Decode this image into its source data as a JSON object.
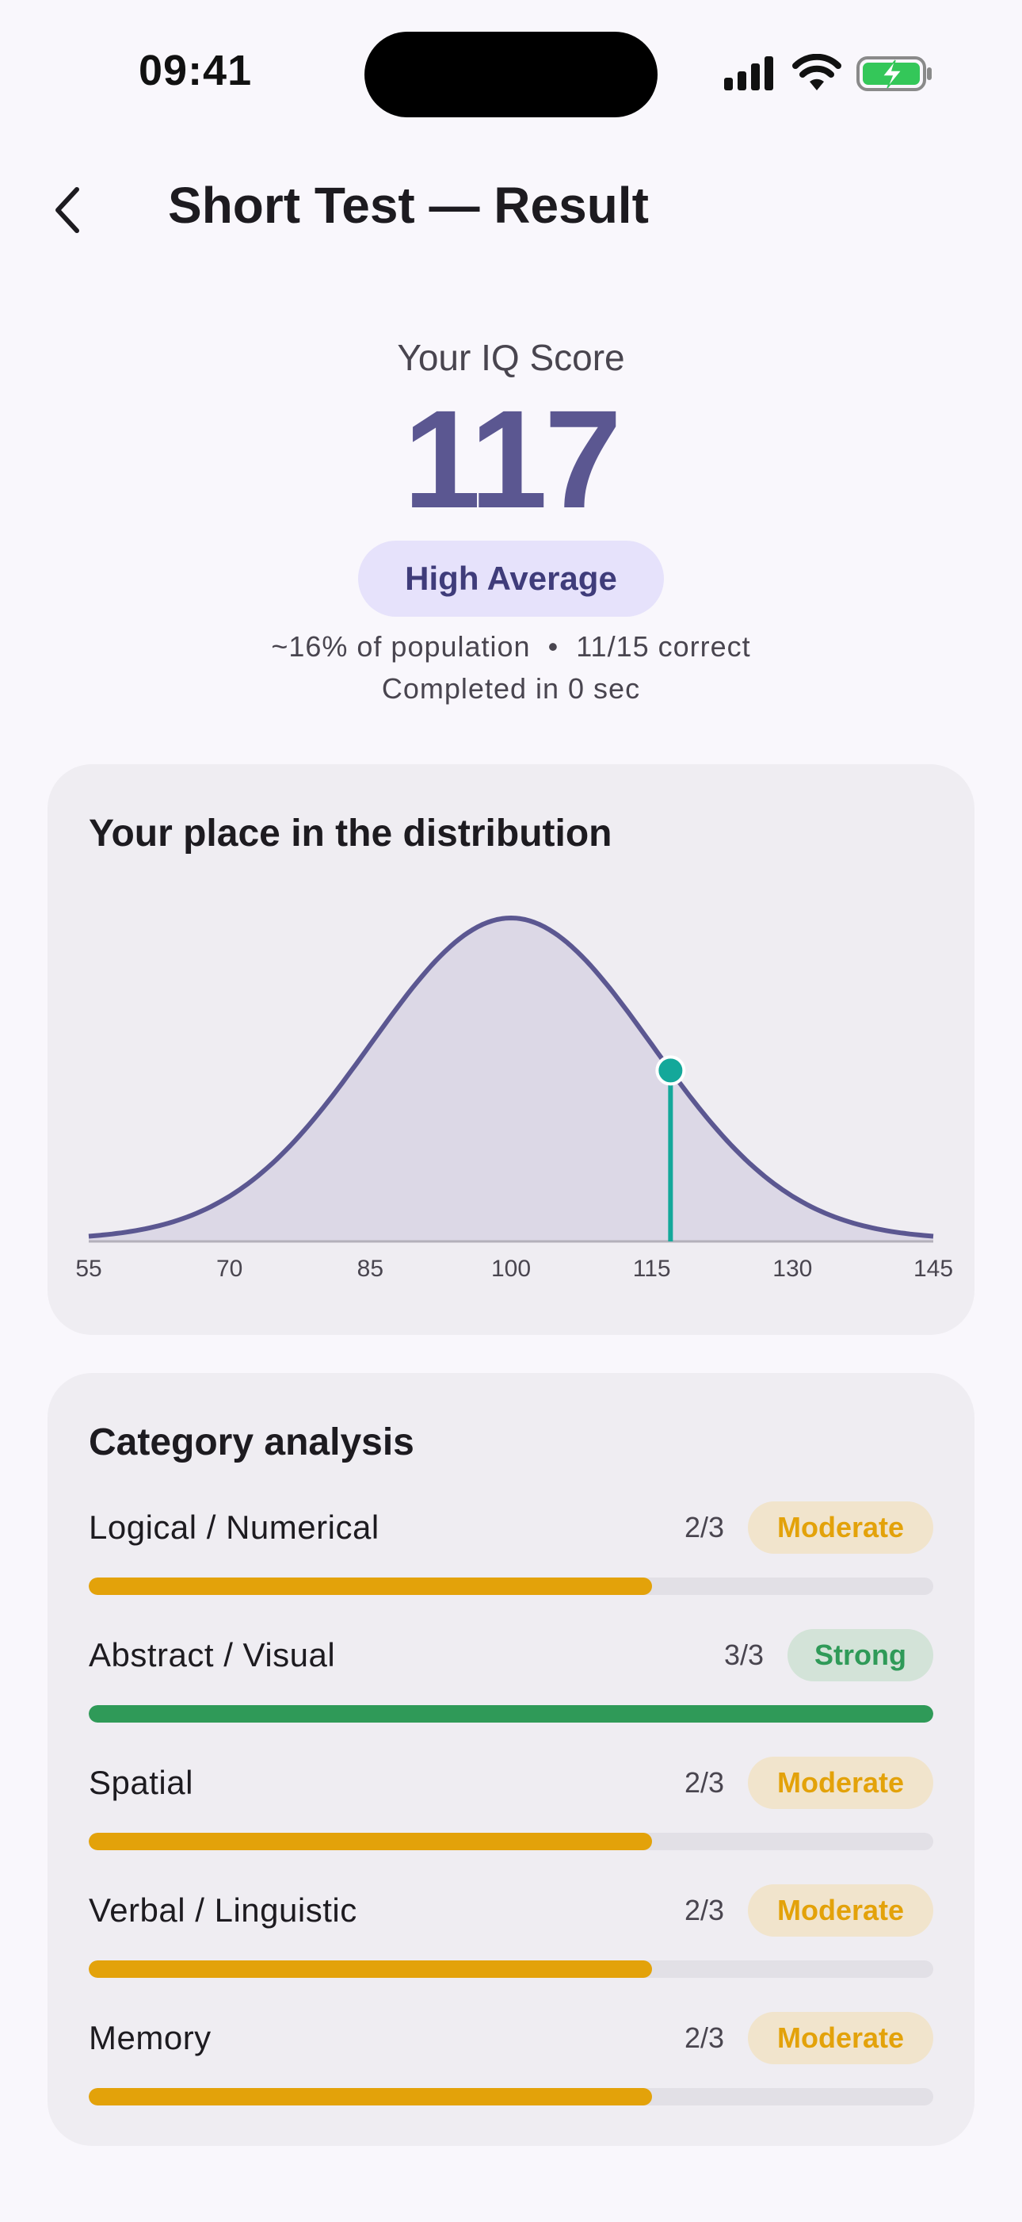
{
  "status_bar": {
    "time": "09:41"
  },
  "header": {
    "title": "Short Test — Result"
  },
  "score": {
    "label": "Your IQ Score",
    "value": "117",
    "classification": "High Average",
    "population": "~16% of population",
    "separator": "•",
    "correct": "11/15 correct",
    "completed": "Completed in 0 sec"
  },
  "distribution": {
    "title": "Your place in the distribution",
    "chart_data": {
      "type": "area",
      "curve": "normal",
      "mean": 100,
      "sd": 15,
      "xlim": [
        55,
        145
      ],
      "ticks": [
        "55",
        "70",
        "85",
        "100",
        "115",
        "130",
        "145"
      ],
      "marker": 117
    }
  },
  "categories": {
    "title": "Category analysis",
    "items": [
      {
        "name": "Logical / Numerical",
        "score": "2/3",
        "level": "Moderate",
        "fraction": 0.667
      },
      {
        "name": "Abstract / Visual",
        "score": "3/3",
        "level": "Strong",
        "fraction": 1.0
      },
      {
        "name": "Spatial",
        "score": "2/3",
        "level": "Moderate",
        "fraction": 0.667
      },
      {
        "name": "Verbal / Linguistic",
        "score": "2/3",
        "level": "Moderate",
        "fraction": 0.667
      },
      {
        "name": "Memory",
        "score": "2/3",
        "level": "Moderate",
        "fraction": 0.667
      }
    ]
  },
  "colors": {
    "accent": "#5b5791",
    "marker": "#14a89a",
    "moderate": "#e3a20a",
    "moderate_bg": "#f1e4cc",
    "strong": "#2f9a58",
    "strong_bg": "#d3e3d8"
  }
}
